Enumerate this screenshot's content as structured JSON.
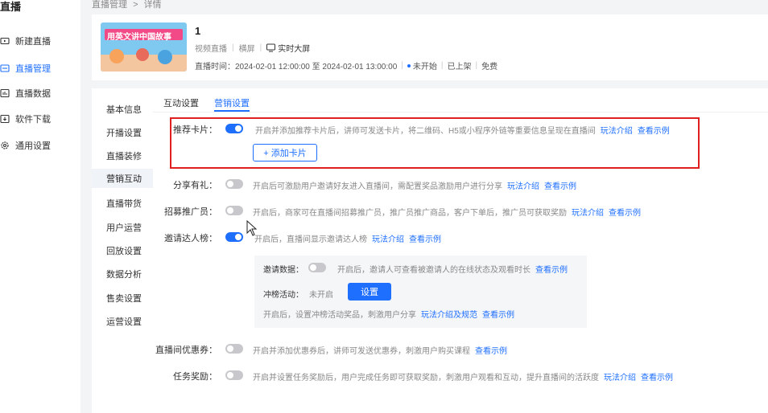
{
  "sidebar": {
    "title": "直播",
    "items": [
      {
        "label": "新建直播",
        "icon": "video-icon"
      },
      {
        "label": "直播管理",
        "icon": "monitor-icon",
        "active": true
      },
      {
        "label": "直播数据",
        "icon": "chart-icon"
      },
      {
        "label": "软件下载",
        "icon": "download-icon"
      },
      {
        "label": "通用设置",
        "icon": "gear-icon"
      }
    ]
  },
  "breadcrumb": {
    "parent": "直播管理",
    "sep": ">",
    "current": "详情"
  },
  "live": {
    "title": "1",
    "thumb_text": "用英文讲中国故事",
    "type": "视频直播",
    "orientation": "横屏",
    "bigscreen": "实时大屏",
    "time_label": "直播时间：",
    "time_value": "2024-02-01 12:00:00 至 2024-02-01 13:00:00",
    "status": "未开始",
    "shelf": "已上架",
    "price": "免费"
  },
  "subnav": [
    "基本信息",
    "开播设置",
    "直播装修",
    "营销互动",
    "直播带货",
    "用户运营",
    "回放设置",
    "数据分析",
    "售卖设置",
    "运营设置"
  ],
  "tabs": [
    "互动设置",
    "营销设置"
  ],
  "settings": {
    "card": {
      "label": "推荐卡片：",
      "desc": "开启并添加推荐卡片后，讲师可发送卡片，将二维码、H5或小程序外链等重要信息呈现在直播间",
      "link1": "玩法介绍",
      "link2": "查看示例",
      "add": "+ 添加卡片"
    },
    "share": {
      "label": "分享有礼：",
      "desc": "开启后可激励用户邀请好友进入直播间，需配置奖品激励用户进行分享",
      "link1": "玩法介绍",
      "link2": "查看示例"
    },
    "promoter": {
      "label": "招募推广员：",
      "desc": "开启后，商家可在直播间招募推广员，推广员推广商品，客户下单后，推广员可获取奖励",
      "link1": "玩法介绍",
      "link2": "查看示例"
    },
    "invite": {
      "label": "邀请达人榜：",
      "desc": "开启后，直播间显示邀请达人榜",
      "link1": "玩法介绍",
      "link2": "查看示例"
    },
    "invite_data": {
      "label": "邀请数据：",
      "desc": "开启后，邀请人可查看被邀请人的在线状态及观看时长",
      "link": "查看示例"
    },
    "rank": {
      "label": "冲榜活动：",
      "value": "未开启",
      "button": "设置",
      "desc": "开启后，设置冲榜活动奖品，刺激用户分享",
      "link1": "玩法介绍及规范",
      "link2": "查看示例"
    },
    "coupon": {
      "label": "直播间优惠券：",
      "desc": "开启并添加优惠券后，讲师可发送优惠券，刺激用户购买课程",
      "link": "查看示例"
    },
    "task": {
      "label": "任务奖励：",
      "desc": "开启并设置任务奖励后，用户完成任务即可获取奖励，刺激用户观看和互动，提升直播间的活跃度",
      "link1": "玩法介绍",
      "link2": "查看示例"
    }
  }
}
